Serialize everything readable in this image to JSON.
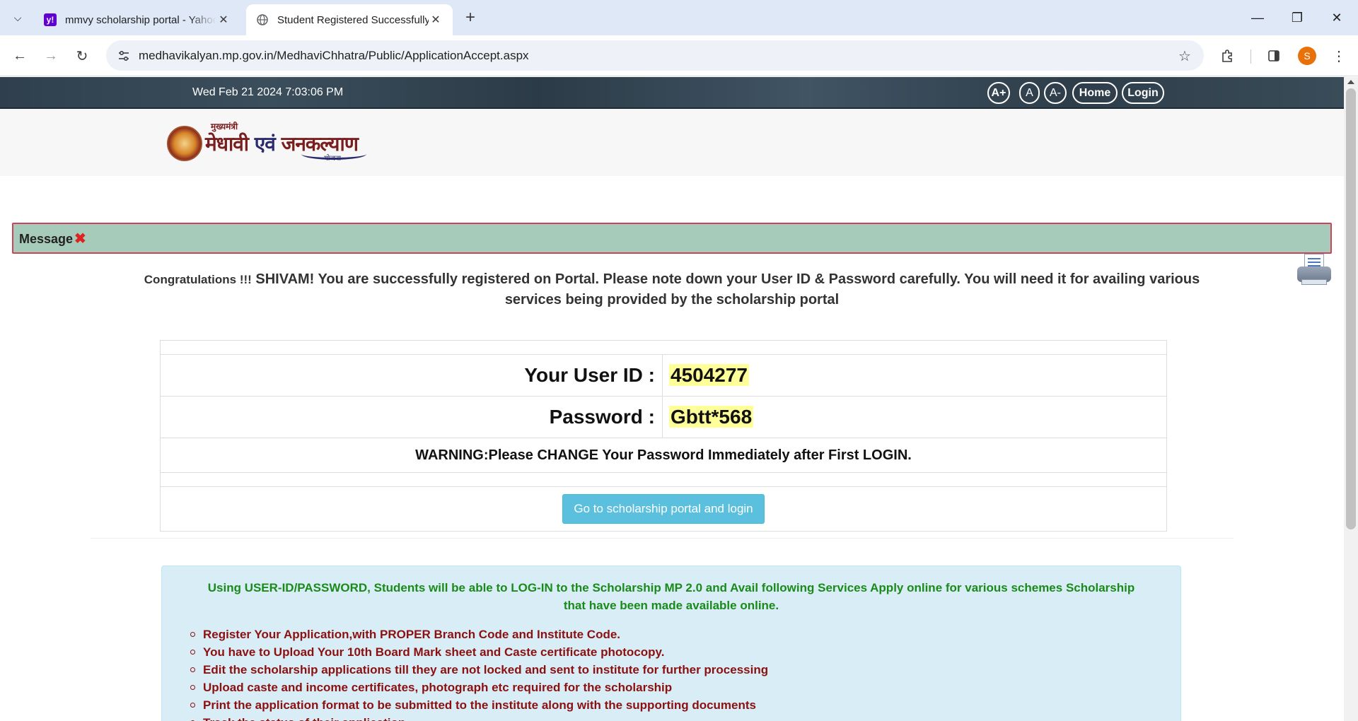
{
  "browser": {
    "tabs": [
      {
        "title": "mmvy scholarship portal - Yahoo Search Results",
        "favicon": "yahoo-icon"
      },
      {
        "title": "Student Registered Successfully",
        "favicon": "globe-icon"
      }
    ],
    "url": "medhavikalyan.mp.gov.in/MedhaviChhatra/Public/ApplicationAccept.aspx",
    "profile_initial": "S"
  },
  "header": {
    "datetime": "Wed Feb 21 2024 7:03:06 PM",
    "font_increase": "A+",
    "font_normal": "A",
    "font_decrease": "A-",
    "home": "Home",
    "login": "Login"
  },
  "logo": {
    "small_text": "मुख्यमंत्री",
    "main_text_1": "मेधावी",
    "main_text_2": " एवं ",
    "main_text_3": "जनकल्याण",
    "yojana": "योजना"
  },
  "message": {
    "label": "Message",
    "congrats_prefix": "Congratulations !!!",
    "congrats_text": " SHIVAM! You are successfully registered on Portal. Please note down your User ID & Password carefully. You will need it for availing various services being provided by the scholarship portal"
  },
  "credentials": {
    "user_id_label": "Your User ID :",
    "user_id": "4504277",
    "password_label": "Password :",
    "password": "Gbtt*568",
    "warning": "WARNING:Please CHANGE Your Password Immediately after First LOGIN.",
    "go_button": "Go to scholarship portal and login"
  },
  "info": {
    "heading": "Using USER-ID/PASSWORD, Students will be able to LOG-IN to the Scholarship MP 2.0 and Avail following Services Apply online for various schemes Scholarship that have been made available online.",
    "items": [
      "Register Your Application,with PROPER Branch Code and Institute Code.",
      "You have to Upload Your 10th Board Mark sheet and Caste certificate photocopy.",
      "Edit the scholarship applications till they are not locked and sent to institute for further processing",
      "Upload caste and income certificates, photograph etc required for the scholarship",
      "Print the application format to be submitted to the institute along with the supporting documents",
      "Track the status of their application"
    ]
  }
}
